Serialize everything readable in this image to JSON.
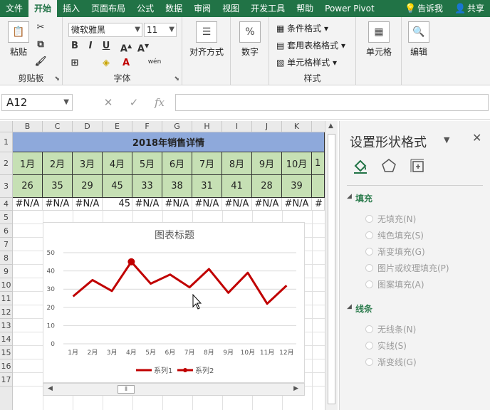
{
  "menu": {
    "tabs": [
      "文件",
      "开始",
      "插入",
      "页面布局",
      "公式",
      "数据",
      "审阅",
      "视图",
      "开发工具",
      "帮助",
      "Power Pivot"
    ],
    "active_tab": "开始",
    "tell_me": "告诉我",
    "share": "共享"
  },
  "ribbon": {
    "clipboard": {
      "paste": "粘贴",
      "label": "剪贴板"
    },
    "font": {
      "name": "微软雅黑",
      "size": "11",
      "label": "字体",
      "bold": "B",
      "italic": "I",
      "underline": "U",
      "phonetic": "wén"
    },
    "alignment": {
      "label": "对齐方式"
    },
    "number": {
      "label": "数字",
      "icon_text": "%"
    },
    "styles": {
      "conditional": "条件格式",
      "table": "套用表格格式",
      "cell": "单元格样式",
      "label": "样式"
    },
    "cells": {
      "label": "单元格"
    },
    "editing": {
      "label": "编辑"
    }
  },
  "formula_bar": {
    "name_box": "A12",
    "fx": "fx",
    "value": ""
  },
  "sheet": {
    "columns": [
      "B",
      "C",
      "D",
      "E",
      "F",
      "G",
      "H",
      "I",
      "J",
      "K"
    ],
    "rows": [
      "1",
      "2",
      "3",
      "4",
      "5",
      "6",
      "7",
      "8",
      "9",
      "10",
      "11",
      "12",
      "13",
      "14",
      "15",
      "16",
      "17"
    ],
    "title": "2018年销售详情",
    "months": [
      "1月",
      "2月",
      "3月",
      "4月",
      "5月",
      "6月",
      "7月",
      "8月",
      "9月",
      "10月",
      "1"
    ],
    "values": [
      "26",
      "35",
      "29",
      "45",
      "33",
      "38",
      "31",
      "41",
      "28",
      "39",
      ""
    ],
    "row4": [
      "#N/A",
      "#N/A",
      "#N/A",
      "45",
      "#N/A",
      "#N/A",
      "#N/A",
      "#N/A",
      "#N/A",
      "#N/A",
      "#"
    ]
  },
  "chart_data": {
    "type": "line",
    "title": "图表标题",
    "categories": [
      "1月",
      "2月",
      "3月",
      "4月",
      "5月",
      "6月",
      "7月",
      "8月",
      "9月",
      "10月",
      "11月",
      "12月"
    ],
    "series": [
      {
        "name": "系列1",
        "values": [
          26,
          35,
          29,
          45,
          33,
          38,
          31,
          41,
          28,
          39,
          22,
          32
        ]
      },
      {
        "name": "系列2",
        "values": [
          null,
          null,
          null,
          45,
          null,
          null,
          null,
          null,
          null,
          null,
          null,
          null
        ]
      }
    ],
    "ylim": [
      0,
      50
    ],
    "yticks": [
      "0",
      "10",
      "20",
      "30",
      "40",
      "50"
    ],
    "grid": true,
    "legend": "bottom",
    "colors": {
      "line": "#c00000",
      "grid": "#d9d9d9"
    }
  },
  "pane": {
    "title": "设置形状格式",
    "fill_header": "填充",
    "fill_options": [
      "无填充(N)",
      "纯色填充(S)",
      "渐变填充(G)",
      "图片或纹理填充(P)",
      "图案填充(A)"
    ],
    "line_header": "线条",
    "line_options": [
      "无线条(N)",
      "实线(S)",
      "渐变线(G)"
    ]
  },
  "colors": {
    "accent": "#217346",
    "title_fill": "#8ea9db",
    "band_fill": "#c6e0b4"
  }
}
